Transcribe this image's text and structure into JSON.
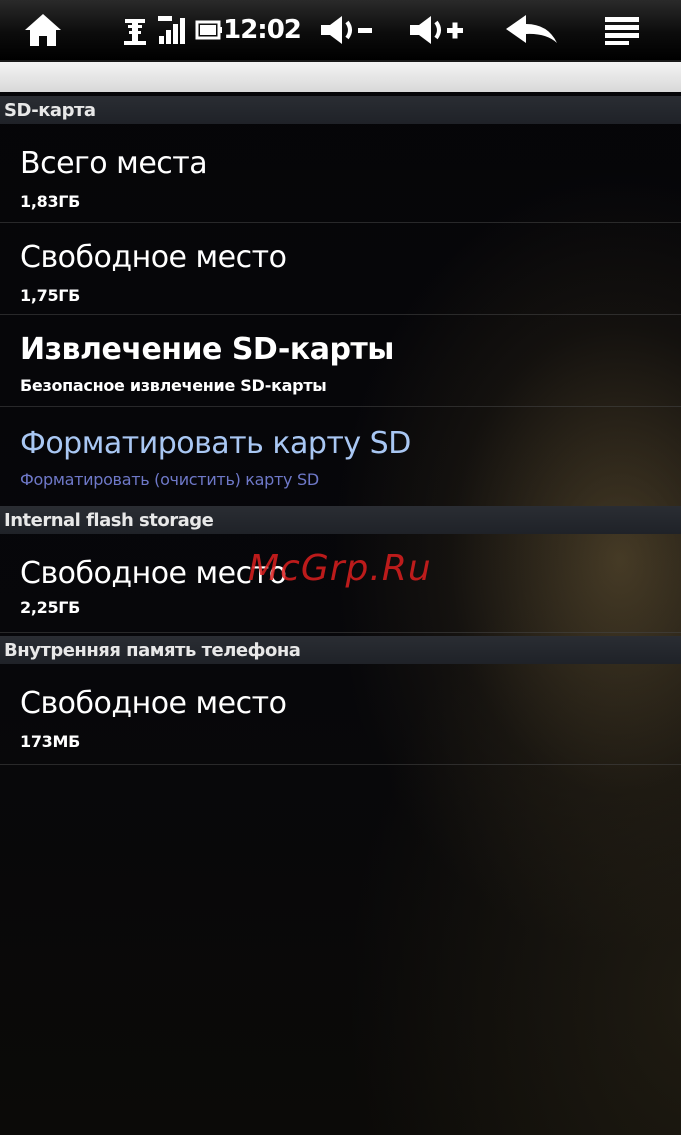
{
  "status_bar": {
    "time": "12:02",
    "icons": [
      "home-icon",
      "usb-icon",
      "signal-icon",
      "battery-icon",
      "volume-down-icon",
      "volume-up-icon",
      "back-icon",
      "menu-icon"
    ]
  },
  "sections": [
    {
      "header": "SD-карта",
      "items": [
        {
          "title": "Всего места",
          "summary": "1,83ГБ"
        },
        {
          "title": "Свободное место",
          "summary": "1,75ГБ"
        },
        {
          "title": "Извлечение SD-карты",
          "summary": "Безопасное извлечение SD-карты"
        },
        {
          "title": "Форматировать карту SD",
          "summary": "Форматировать (очистить) карту SD",
          "enabled": false
        }
      ]
    },
    {
      "header": "Internal flash storage",
      "items": [
        {
          "title": "Свободное место",
          "summary": "2,25ГБ"
        }
      ]
    },
    {
      "header": "Внутренняя память телефона",
      "items": [
        {
          "title": "Свободное место",
          "summary": "173МБ"
        }
      ]
    }
  ],
  "watermark": "McGrp.Ru",
  "colors": {
    "disabled_title": "#a9c7f3",
    "disabled_summary": "#6e78c8",
    "section_bg": "#24272d",
    "watermark": "#dc1e1e"
  }
}
